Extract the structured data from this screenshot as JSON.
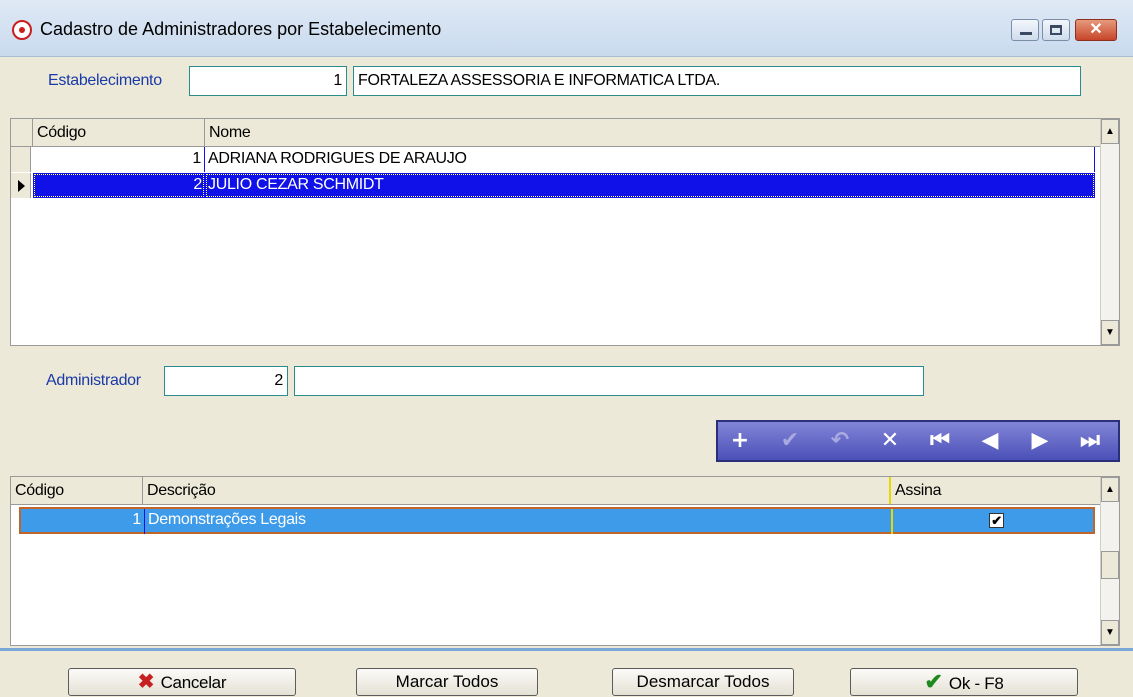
{
  "window": {
    "title": "Cadastro de Administradores por Estabelecimento",
    "close_glyph": "✕"
  },
  "estabelecimento": {
    "label": "Estabelecimento",
    "code": "1",
    "name": "FORTALEZA ASSESSORIA E INFORMATICA LTDA."
  },
  "admins_grid": {
    "headers": [
      "Código",
      "Nome"
    ],
    "rows": [
      {
        "codigo": "1",
        "nome": "ADRIANA RODRIGUES DE ARAUJO"
      },
      {
        "codigo": "2",
        "nome": "JULIO CEZAR SCHMIDT"
      }
    ]
  },
  "administrador": {
    "label": "Administrador",
    "code": "2",
    "name": ""
  },
  "navigator": {
    "buttons": [
      "+",
      "✔",
      "↶",
      "✕",
      "⏮",
      "◀",
      "▶",
      "⏭"
    ]
  },
  "desc_grid": {
    "headers": [
      "Código",
      "Descrição",
      "Assina"
    ],
    "rows": [
      {
        "codigo": "1",
        "descricao": "Demonstrações Legais",
        "assina": "✔"
      }
    ]
  },
  "buttons": {
    "cancel": "Cancelar",
    "mark_all": "Marcar Todos",
    "unmark_all": "Desmarcar Todos",
    "ok": "Ok - F8"
  },
  "icons": {
    "cancel": "✖",
    "ok": "✔",
    "scroll_up": "▲",
    "scroll_down": "▼"
  },
  "colors": {
    "selection": "#1010e8",
    "row_highlight": "#3d9be9",
    "label": "#1a3aa8"
  }
}
